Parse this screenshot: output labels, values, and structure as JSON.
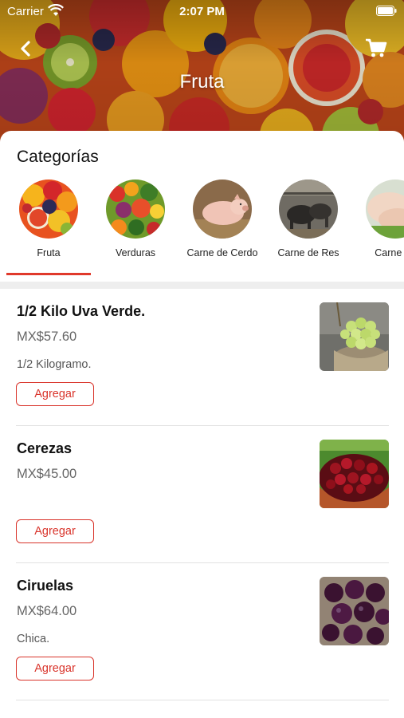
{
  "status": {
    "carrier": "Carrier",
    "time": "2:07 PM"
  },
  "header": {
    "title": "Fruta",
    "back_icon": "chevron-left-icon",
    "cart_icon": "cart-icon"
  },
  "categories": {
    "heading": "Categorías",
    "selected": "Fruta",
    "items": [
      {
        "label": "Fruta"
      },
      {
        "label": "Verduras"
      },
      {
        "label": "Carne de Cerdo"
      },
      {
        "label": "Carne de Res"
      },
      {
        "label": "Carne de"
      }
    ]
  },
  "products": [
    {
      "name": "1/2 Kilo Uva Verde.",
      "price": "MX$57.60",
      "description": "1/2 Kilogramo.",
      "button": "Agregar"
    },
    {
      "name": "Cerezas",
      "price": "MX$45.00",
      "description": "",
      "button": "Agregar"
    },
    {
      "name": "Ciruelas",
      "price": "MX$64.00",
      "description": "Chica.",
      "button": "Agregar"
    }
  ],
  "colors": {
    "accent": "#d9342b",
    "divider": "#eeeeee"
  }
}
